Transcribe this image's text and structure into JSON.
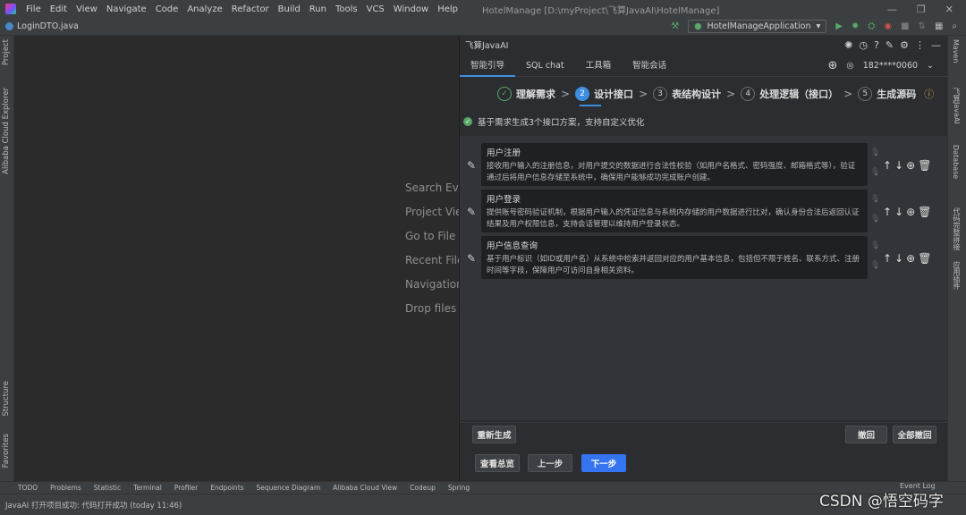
{
  "menu": [
    "File",
    "Edit",
    "View",
    "Navigate",
    "Code",
    "Analyze",
    "Refactor",
    "Build",
    "Run",
    "Tools",
    "VCS",
    "Window",
    "Help"
  ],
  "window_title": "HotelManage [D:\\myProject\\飞算JavaAI\\HotelManage]",
  "file_tab": "LoginDTO.java",
  "run_config": "HotelManageApplication",
  "left_strip": [
    "Project",
    "Alibaba Cloud Explorer",
    "Structure",
    "Favorites"
  ],
  "right_strip": [
    "Maven",
    "飞算JavaAI",
    "Database",
    "代码完整拼接",
    "应用插件"
  ],
  "editor_hints": [
    "Search Everywhere",
    "Project View",
    "Go to File",
    "Recent Files",
    "Navigation Bar",
    "Drop files here to open them"
  ],
  "panel": {
    "title": "飞算JavaAI",
    "tabs": [
      "智能引导",
      "SQL chat",
      "工具箱",
      "智能会话"
    ],
    "user": "182****0060",
    "steps": [
      {
        "num": "✓",
        "label": "理解需求",
        "state": "done"
      },
      {
        "num": "2",
        "label": "设计接口",
        "state": "current"
      },
      {
        "num": "3",
        "label": "表结构设计",
        "state": "todo"
      },
      {
        "num": "4",
        "label": "处理逻辑（接口）",
        "state": "todo"
      },
      {
        "num": "5",
        "label": "生成源码",
        "state": "todo"
      }
    ],
    "notice": "基于需求生成3个接口方案，支持自定义优化",
    "cards": [
      {
        "title": "用户注册",
        "desc": "接收用户输入的注册信息，对用户提交的数据进行合法性校验（如用户名格式、密码强度、邮箱格式等），验证通过后将用户信息存储至系统中，确保用户能够成功完成账户创建。"
      },
      {
        "title": "用户登录",
        "desc": "提供账号密码验证机制，根据用户输入的凭证信息与系统内存储的用户数据进行比对，确认身份合法后返回认证结果及用户权限信息，支持会话管理以维持用户登录状态。"
      },
      {
        "title": "用户信息查询",
        "desc": "基于用户标识（如ID或用户名）从系统中检索并返回对应的用户基本信息，包括但不限于姓名、联系方式、注册时间等字段，保障用户可访问自身相关资料。"
      }
    ],
    "buttons": {
      "regen": "重新生成",
      "undo": "撤回",
      "undo_all": "全部撤回",
      "overview": "查看总览",
      "prev": "上一步",
      "next": "下一步"
    }
  },
  "toolbar": [
    "TODO",
    "Problems",
    "Statistic",
    "Terminal",
    "Profiler",
    "Endpoints",
    "Sequence Diagram",
    "Alibaba Cloud View",
    "Codeup",
    "Spring"
  ],
  "event_log": "Event Log",
  "status": "JavaAI 打开项目成功: 代码打开成功 (today 11:46)",
  "watermark": "CSDN @悟空码字"
}
